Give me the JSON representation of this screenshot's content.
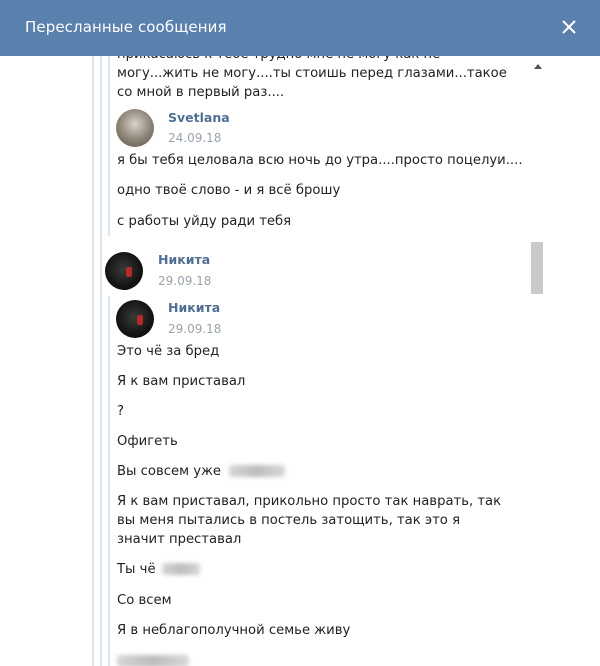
{
  "window": {
    "title": "Пересланные сообщения"
  },
  "messages": {
    "top_cut_text": "прикасаюсь к тебе трудно мне не могу как не могу...жить не могу....ты стоишь перед глазами...такое со мной в первый раз....",
    "svetlana": {
      "name": "Svetlana",
      "date": "24.09.18",
      "lines": [
        "я бы тебя целовала всю ночь до утра....просто поцелуи....",
        "одно твоё слово - и я всё брошу",
        "с работы уйду ради тебя"
      ]
    },
    "nikita_outer": {
      "name": "Никита",
      "date": "29.09.18"
    },
    "nikita_inner": {
      "name": "Никита",
      "date": "29.09.18",
      "lines": [
        "Это чё за бред",
        "Я к вам приставал",
        "?",
        "Офигеть",
        "Вы совсем уже",
        "Я к вам приставал, прикольно просто так наврать, так вы меня пытались в постель затощить, так это я значит преставал",
        "Ты чё",
        "Со всем",
        "Я в неблагополучной семье живу"
      ]
    }
  },
  "colors": {
    "titlebar": "#5a80ad",
    "author_name": "#4f6f94",
    "date": "#9aa3ad",
    "text": "#222222"
  },
  "icons": {
    "close": "close-icon",
    "scroll_up": "chevron-up-icon"
  }
}
